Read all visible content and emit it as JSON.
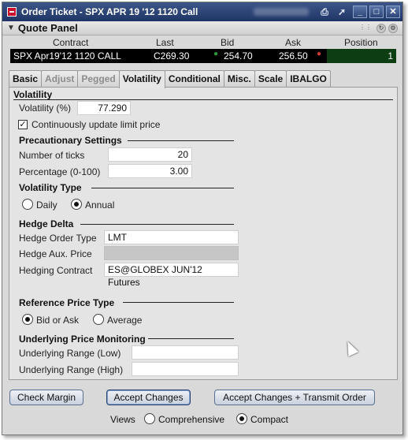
{
  "window": {
    "title": "Order Ticket - SPX APR 19 '12 1120 Call",
    "minimize_label": "_",
    "maximize_label": "□",
    "close_label": "✕"
  },
  "quote_panel": {
    "title": "Quote Panel",
    "columns": [
      "Contract",
      "Last",
      "Bid",
      "Ask",
      "Position"
    ],
    "row": {
      "contract": "SPX Apr19'12 1120 CALL",
      "last": "C269.30",
      "bid": "254.70",
      "ask": "256.50",
      "position": "1"
    },
    "colors": {
      "bid_dot": "#2e9d3a",
      "ask_dot": "#d23b3b",
      "position_bg": "#0c3d13"
    }
  },
  "tabs": [
    {
      "label": "Basic",
      "state": "normal"
    },
    {
      "label": "Adjust",
      "state": "disabled"
    },
    {
      "label": "Pegged",
      "state": "disabled"
    },
    {
      "label": "Volatility",
      "state": "active"
    },
    {
      "label": "Conditional",
      "state": "normal"
    },
    {
      "label": "Misc.",
      "state": "normal"
    },
    {
      "label": "Scale",
      "state": "normal"
    },
    {
      "label": "IBALGO",
      "state": "normal"
    }
  ],
  "volatility": {
    "section": "Volatility",
    "label": "Volatility (%)",
    "value": "77.290",
    "continuous_label": "Continuously update limit price",
    "continuous_checked": true
  },
  "precautionary": {
    "section": "Precautionary Settings",
    "ticks_label": "Number of ticks",
    "ticks_value": "20",
    "percentage_label": "Percentage (0-100)",
    "percentage_value": "3.00"
  },
  "volatility_type": {
    "section": "Volatility Type",
    "daily_label": "Daily",
    "annual_label": "Annual",
    "selected": "Annual"
  },
  "hedge_delta": {
    "section": "Hedge Delta",
    "order_type_label": "Hedge Order Type",
    "order_type_value": "LMT",
    "aux_price_label": "Hedge Aux. Price",
    "aux_price_value": "",
    "contract_label": "Hedging Contract",
    "contract_value": "ES@GLOBEX JUN'12 Futures"
  },
  "reference_price": {
    "section": "Reference Price Type",
    "bid_ask_label": "Bid or Ask",
    "average_label": "Average",
    "selected": "Bid or Ask"
  },
  "underlying": {
    "section": "Underlying Price Monitoring",
    "low_label": "Underlying Range (Low)",
    "low_value": "",
    "high_label": "Underlying Range (High)",
    "high_value": ""
  },
  "buttons": {
    "check_margin": "Check Margin",
    "accept": "Accept Changes",
    "accept_transmit": "Accept Changes + Transmit Order"
  },
  "views": {
    "label": "Views",
    "comprehensive_label": "Comprehensive",
    "compact_label": "Compact",
    "selected": "Compact"
  }
}
